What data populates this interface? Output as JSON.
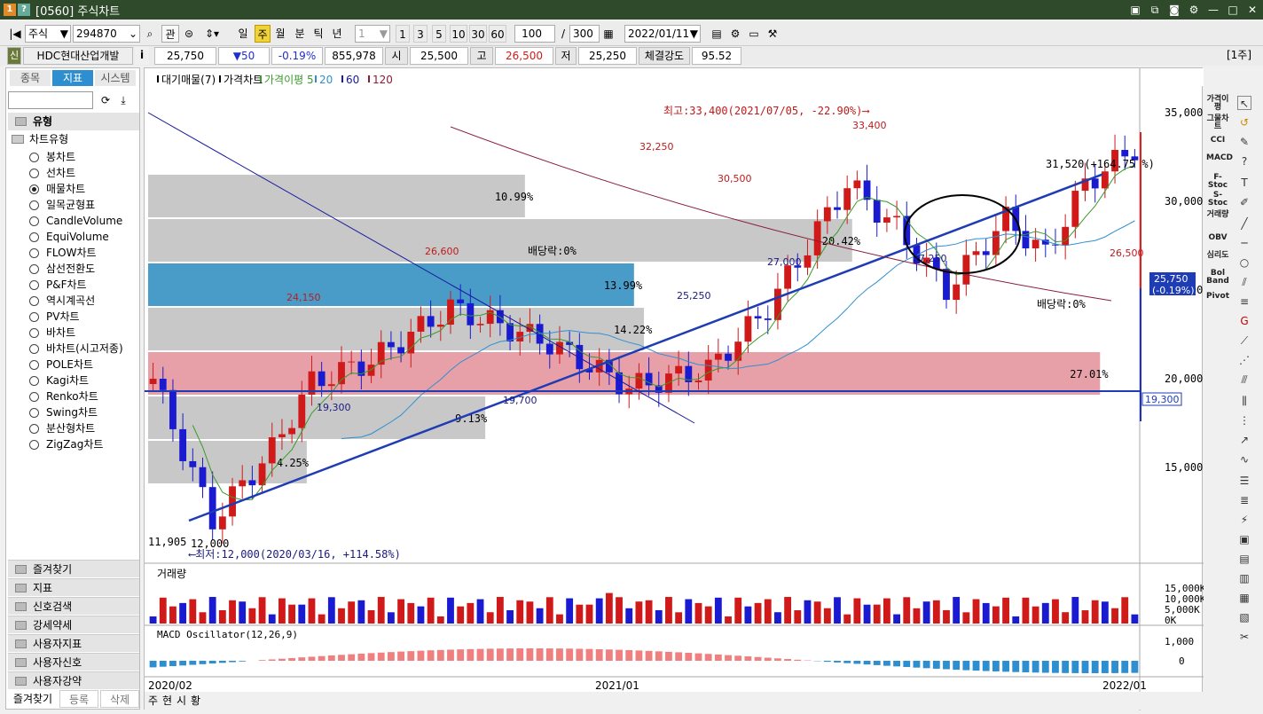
{
  "window": {
    "number": "1",
    "help": "?",
    "title": "[0560] 주식차트"
  },
  "toolbar": {
    "market": "주식",
    "code": "294870",
    "search_icon": "search-icon",
    "btn_gwan": "관",
    "periods": [
      "일",
      "주",
      "월",
      "분",
      "틱",
      "년"
    ],
    "active_period": "주",
    "unit_select": "1",
    "quick_units": [
      "1",
      "3",
      "5",
      "10",
      "30",
      "60"
    ],
    "count_value": "100",
    "count_sep": "/",
    "count_total": "300",
    "date": "2022/01/11"
  },
  "infobar": {
    "badge": "신",
    "name": "HDC현대산업개발",
    "info_icon": "i",
    "price": "25,750",
    "change": "▼50",
    "change_pct": "-0.19%",
    "volume": "855,978",
    "open_label": "시",
    "open": "25,500",
    "high_label": "고",
    "high": "26,500",
    "low_label": "저",
    "low": "25,250",
    "strength_label": "체결강도",
    "strength": "95.52",
    "page": "[1주]"
  },
  "left": {
    "tabs": [
      "종목",
      "지표",
      "시스템"
    ],
    "active_tab": "지표",
    "section": "유형",
    "group": "차트유형",
    "chart_types": [
      "봉차트",
      "선차트",
      "매물차트",
      "일목균형표",
      "CandleVolume",
      "EquiVolume",
      "FLOW차트",
      "삼선전환도",
      "P&F차트",
      "역시계곡선",
      "PV차트",
      "바차트",
      "바차트(시고저종)",
      "POLE차트",
      "Kagi차트",
      "Renko차트",
      "Swing차트",
      "분산형차트",
      "ZigZag차트"
    ],
    "selected": "매물차트",
    "folders": [
      "즐겨찾기",
      "지표",
      "신호검색",
      "강세약세",
      "사용자지표",
      "사용자신호",
      "사용자강약"
    ],
    "bottom": [
      "즐겨찾기",
      "등록",
      "삭제"
    ]
  },
  "legend": {
    "items": [
      {
        "label": "대기매물(7)",
        "color": "#000"
      },
      {
        "label": "가격차트",
        "color": "#000"
      },
      {
        "label": "가격이평 5",
        "color": "#3a9a2a"
      },
      {
        "label": "20",
        "color": "#2e8fd0"
      },
      {
        "label": "60",
        "color": "#1a1aa0"
      },
      {
        "label": "120",
        "color": "#8a1a3a"
      }
    ]
  },
  "annotations": {
    "high_note": "최고:33,400(2021/07/05, -22.90%)⟶",
    "low_note": "⟵최저:12,000(2020/03/16, +114.58%)",
    "trend_note": "31,520(+164.75 %)",
    "dividend1": "배당락:0%",
    "dividend2": "배당락:0%",
    "start_note": "11,905",
    "start_low": "12,000",
    "price_tag": "25,750",
    "price_tag_pct": "(-0.19%)",
    "line_tag": "19,300",
    "peaks": [
      "33,400",
      "32,250",
      "30,500",
      "26,600",
      "24,150",
      "27,000",
      "25,250",
      "27,250",
      "26,500"
    ],
    "troughs": [
      "19,300",
      "19,700"
    ]
  },
  "volume_profile": {
    "bands": [
      {
        "pct": "4.25%",
        "width_frac": 0.16
      },
      {
        "pct": "9.13%",
        "width_frac": 0.34
      },
      {
        "pct": "27.01%",
        "width_frac": 0.96,
        "color": "#e8a0a8"
      },
      {
        "pct": "14.22%",
        "width_frac": 0.5
      },
      {
        "pct": "13.99%",
        "width_frac": 0.49,
        "color": "#4a9cc8"
      },
      {
        "pct": "20.42%",
        "width_frac": 0.71
      },
      {
        "pct": "10.99%",
        "width_frac": 0.38
      }
    ]
  },
  "price_axis": {
    "ticks": [
      "35,000",
      "30,000",
      "25,000",
      "20,000",
      "15,000"
    ]
  },
  "volume_panel": {
    "title": "거래량",
    "ticks": [
      "15,000K",
      "10,000K",
      "5,000K",
      "0K"
    ]
  },
  "macd_panel": {
    "title": "MACD Oscillator(12,26,9)",
    "ticks": [
      "1,000",
      "0"
    ]
  },
  "time_axis": {
    "labels": [
      "2020/02",
      "2021/01",
      "2022/01"
    ]
  },
  "bottom_bar": {
    "items": [
      "주",
      "현",
      "시",
      "황"
    ]
  },
  "right_labels": [
    "가격이평",
    "그물차트",
    "CCI",
    "MACD",
    "F-Stoc",
    "S-Stoc",
    "거래량",
    "OBV",
    "심리도",
    "Bol Band",
    "Pivot"
  ],
  "chart_data": {
    "type": "candlestick",
    "x_range": [
      "2020/02",
      "2022/01"
    ],
    "ylim": [
      10000,
      36000
    ],
    "high": 33400,
    "low": 12000,
    "last_close": 25750,
    "support_line": 19300
  }
}
